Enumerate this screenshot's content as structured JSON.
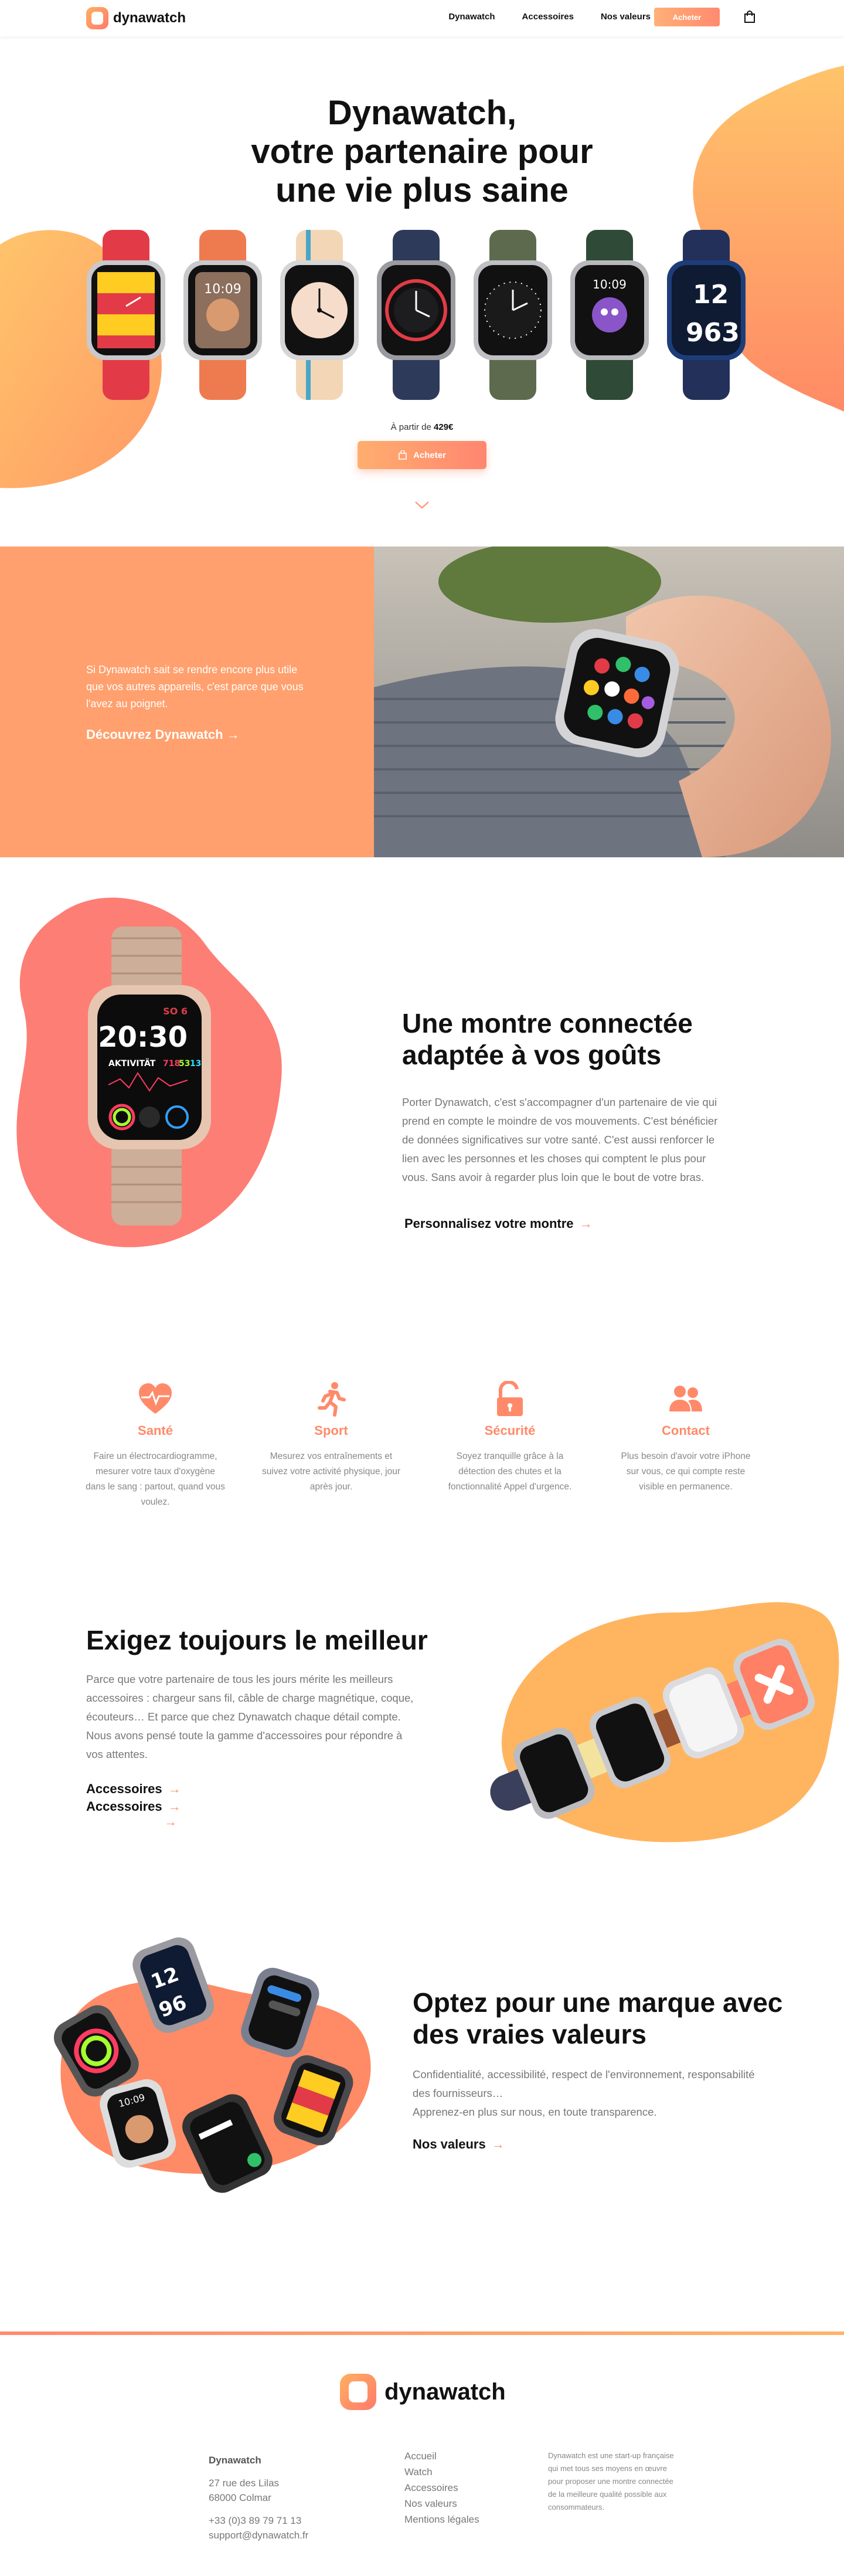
{
  "nav": {
    "brand": "dynawatch",
    "links": [
      "Dynawatch",
      "Accessoires",
      "Nos valeurs"
    ],
    "cta": "Acheter",
    "cart_icon": "shopping-bag-icon"
  },
  "hero": {
    "title_lines": [
      "Dynawatch,",
      "votre partenaire pour",
      "une vie plus saine"
    ],
    "price_prefix": "À partir de",
    "price_value": "429€",
    "buy_label": "Acheter",
    "scroll_icon": "chevron-down-icon"
  },
  "intro": {
    "text": "Si Dynawatch sait se rendre encore plus utile que vos autres appareils, c'est parce que vous l'avez au poignet.",
    "link": "Découvrez Dynawatch →"
  },
  "custom": {
    "title_lines": [
      "Une montre connectée",
      "adaptée à vos goûts"
    ],
    "text": "Porter Dynawatch, c'est s'accompagner d'un partenaire de vie qui prend en compte le moindre de vos mouvements. C'est bénéficier de données significatives sur votre santé. C'est aussi renforcer le lien avec les personnes et les choses qui comptent le plus pour vous. Sans avoir à regarder plus loin que le bout de votre bras.",
    "link": "Personnalisez votre montre",
    "watch_face": {
      "date": "SO 6",
      "time": "20:30",
      "activity": "AKTIVITÄT",
      "activity_values": [
        "718",
        "53",
        "13"
      ]
    }
  },
  "features": [
    {
      "icon": "heart-pulse-icon",
      "title": "Santé",
      "text": "Faire un électrocardiogramme, mesurer votre taux d'oxygène dans le sang : partout, quand vous voulez."
    },
    {
      "icon": "running-icon",
      "title": "Sport",
      "text": "Mesurez vos entraînements et suivez votre activité physique, jour après jour."
    },
    {
      "icon": "lock-icon",
      "title": "Sécurité",
      "text": "Soyez tranquille grâce à la détection des chutes et la fonctionnalité Appel d'urgence."
    },
    {
      "icon": "users-icon",
      "title": "Contact",
      "text": "Plus besoin d'avoir votre iPhone sur vous, ce qui compte reste visible en permanence."
    }
  ],
  "accessories": {
    "title": "Exigez toujours le meilleur",
    "text": "Parce que votre partenaire de tous les jours mérite les meilleurs accessoires : chargeur sans fil, câble de charge magnétique, coque, écouteurs… Et parce que chez Dynawatch chaque détail compte. Nous avons pensé toute la gamme d'accessoires pour répondre à vos attentes.",
    "links": [
      "Accessoires",
      "Accessoires"
    ]
  },
  "values": {
    "title_lines": [
      "Optez pour une marque avec",
      "des vraies valeurs"
    ],
    "text_lines": [
      "Confidentialité, accessibilité, respect de l'environnement, responsabilité des fournisseurs…",
      "Apprenez-en plus sur nous, en toute transparence."
    ],
    "link": "Nos valeurs"
  },
  "footer": {
    "brand": "dynawatch",
    "company": "Dynawatch",
    "address_lines": [
      "27 rue des Lilas",
      "68000 Colmar"
    ],
    "phone": "+33 (0)3 89 79 71 13",
    "email": "support@dynawatch.fr",
    "links": [
      "Accueil",
      "Watch",
      "Accessoires",
      "Nos valeurs",
      "Mentions légales"
    ],
    "about": "Dynawatch est une start-up française qui met tous ses moyens en œuvre pour proposer une montre connectée de la meilleure qualité possible aux consommateurs."
  },
  "colors": {
    "accent": "#ff8a6a",
    "accent_light": "#ffb36a",
    "coral": "#fd7e75",
    "peach": "#ffa06e"
  }
}
